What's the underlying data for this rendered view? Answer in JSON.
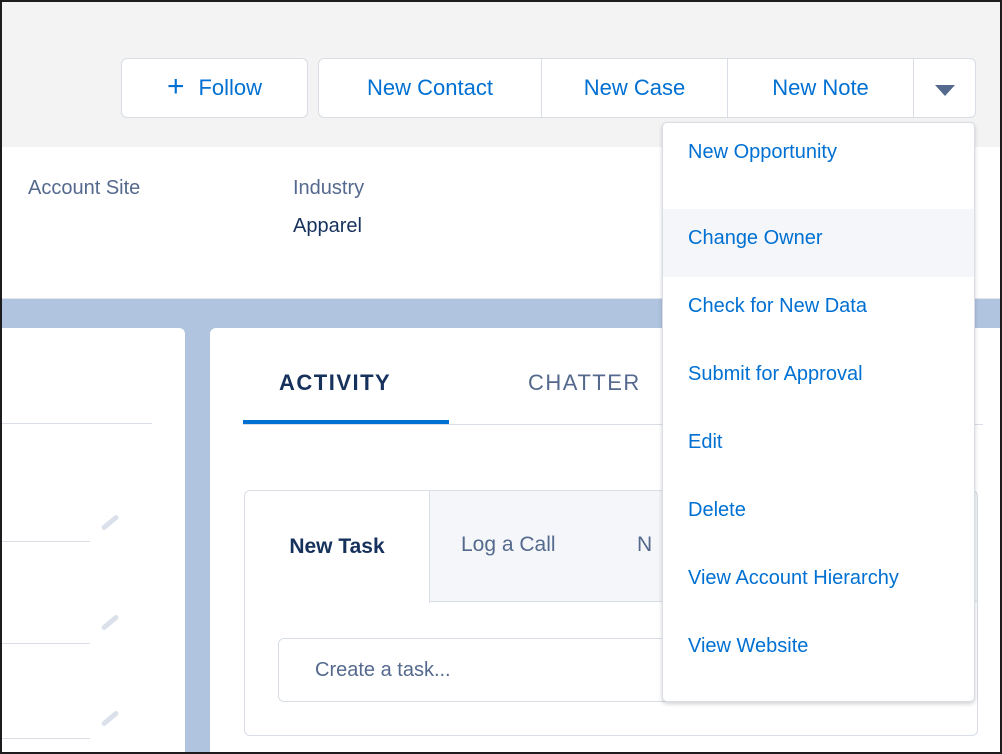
{
  "header": {
    "follow_label": "Follow",
    "actions": [
      "New Contact",
      "New Case",
      "New Note"
    ],
    "more_icon": "chevron-down-icon"
  },
  "highlights": {
    "account_site_label": "Account Site",
    "industry_label": "Industry",
    "industry_value": "Apparel"
  },
  "tabs": {
    "activity": "ACTIVITY",
    "chatter": "CHATTER"
  },
  "publisher": {
    "tabs": [
      "New Task",
      "Log a Call",
      "N"
    ],
    "task_placeholder": "Create a task..."
  },
  "menu": {
    "items": [
      "New Opportunity",
      "Change Owner",
      "Check for New Data",
      "Submit for Approval",
      "Edit",
      "Delete",
      "View Account Hierarchy",
      "View Website"
    ],
    "hovered_index": 1
  },
  "colors": {
    "link": "#0070d2",
    "text": "#16325c",
    "muted": "#54698d",
    "background_band": "#b0c4df"
  }
}
